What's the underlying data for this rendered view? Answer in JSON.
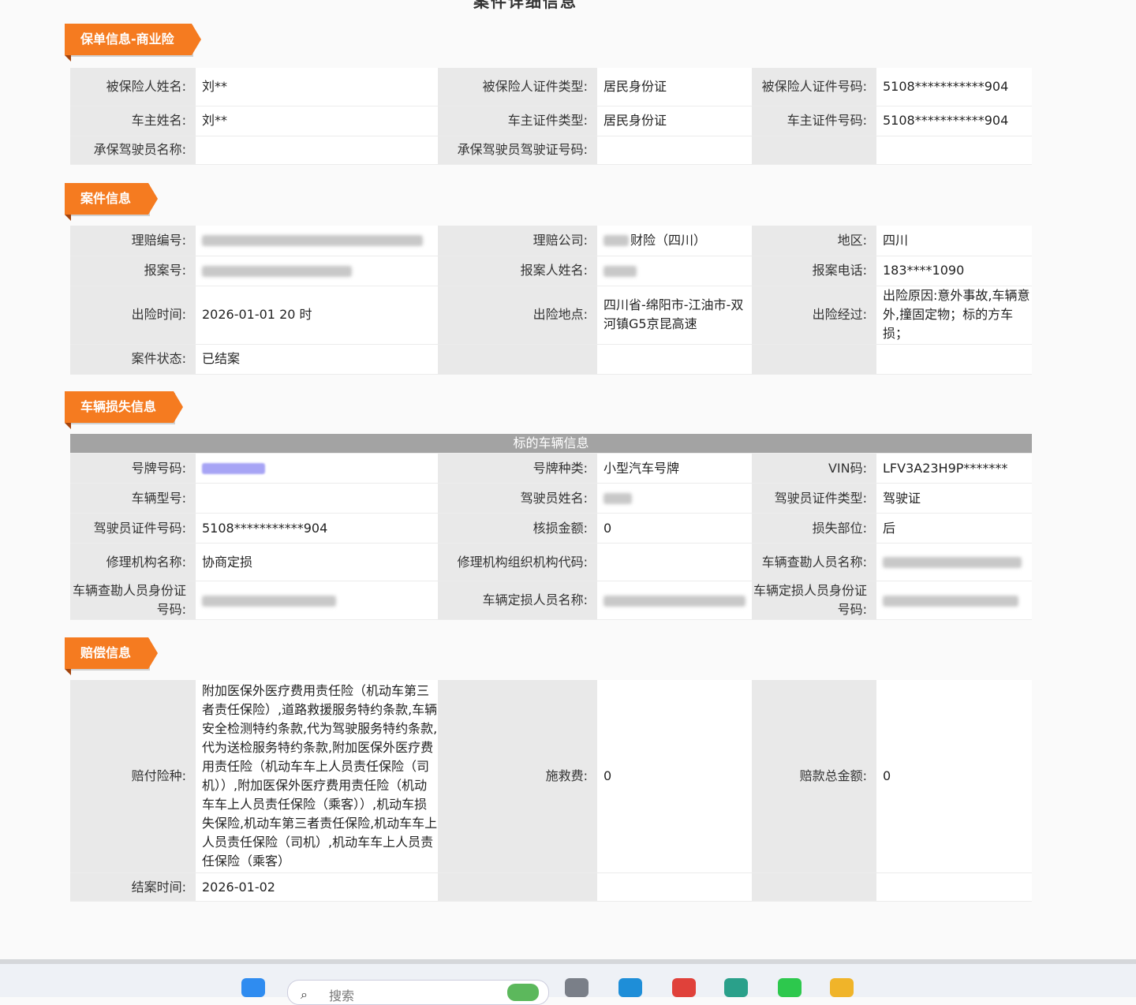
{
  "page_title": "案件详细信息",
  "sections": {
    "policy": "保单信息-商业险",
    "case": "案件信息",
    "vehicle": "车辆损失信息",
    "compensation": "赔偿信息"
  },
  "policy": {
    "insured_name_label": "被保险人姓名:",
    "insured_name": "刘**",
    "insured_id_type_label": "被保险人证件类型:",
    "insured_id_type": "居民身份证",
    "insured_id_no_label": "被保险人证件号码:",
    "insured_id_no": "5108***********904",
    "owner_name_label": "车主姓名:",
    "owner_name": "刘**",
    "owner_id_type_label": "车主证件类型:",
    "owner_id_type": "居民身份证",
    "owner_id_no_label": "车主证件号码:",
    "owner_id_no": "5108***********904",
    "driver_name_label": "承保驾驶员名称:",
    "driver_license_label": "承保驾驶员驾驶证号码:"
  },
  "case": {
    "claim_no_label": "理赔编号:",
    "claim_company_label": "理赔公司:",
    "claim_company": "财险（四川）",
    "region_label": "地区:",
    "region": "四川",
    "report_no_label": "报案号:",
    "reporter_name_label": "报案人姓名:",
    "report_phone_label": "报案电话:",
    "report_phone": "183****1090",
    "accident_time_label": "出险时间:",
    "accident_time": "2026-01-01 20 时",
    "accident_place_label": "出险地点:",
    "accident_place": "四川省-绵阳市-江油市-双河镇G5京昆高速",
    "accident_process_label": "出险经过:",
    "accident_process": "出险原因:意外事故,车辆意外,撞固定物；标的方车损；",
    "case_status_label": "案件状态:",
    "case_status": "已结案"
  },
  "vehicle": {
    "subheader": "标的车辆信息",
    "plate_no_label": "号牌号码:",
    "plate_type_label": "号牌种类:",
    "plate_type": "小型汽车号牌",
    "vin_label": "VIN码:",
    "vin": "LFV3A23H9P*******",
    "model_label": "车辆型号:",
    "driver_name_label": "驾驶员姓名:",
    "driver_id_type_label": "驾驶员证件类型:",
    "driver_id_type": "驾驶证",
    "driver_id_no_label": "驾驶员证件号码:",
    "driver_id_no": "5108***********904",
    "loss_amount_label": "核损金额:",
    "loss_amount": "0",
    "loss_part_label": "损失部位:",
    "loss_part": "后",
    "repair_name_label": "修理机构名称:",
    "repair_name": "协商定损",
    "repair_code_label": "修理机构组织机构代码:",
    "surveyor_name_label": "车辆查勘人员名称:",
    "surveyor_id_label": "车辆查勘人员身份证号码:",
    "assessor_name_label": "车辆定损人员名称:",
    "assessor_id_label": "车辆定损人员身份证号码:"
  },
  "compensation": {
    "coverage_label": "赔付险种:",
    "coverage": "附加医保外医疗费用责任险（机动车第三者责任保险）,道路救援服务特约条款,车辆安全检测特约条款,代为驾驶服务特约条款,代为送检服务特约条款,附加医保外医疗费用责任险（机动车车上人员责任保险（司机））,附加医保外医疗费用责任险（机动车车上人员责任保险（乘客））,机动车损失保险,机动车第三者责任保险,机动车车上人员责任保险（司机）,机动车车上人员责任保险（乘客）",
    "rescue_fee_label": "施救费:",
    "rescue_fee": "0",
    "total_label": "赔款总金额:",
    "total": "0",
    "close_time_label": "结案时间:",
    "close_time": "2026-01-02"
  },
  "taskbar": {
    "search_placeholder": "搜索"
  }
}
